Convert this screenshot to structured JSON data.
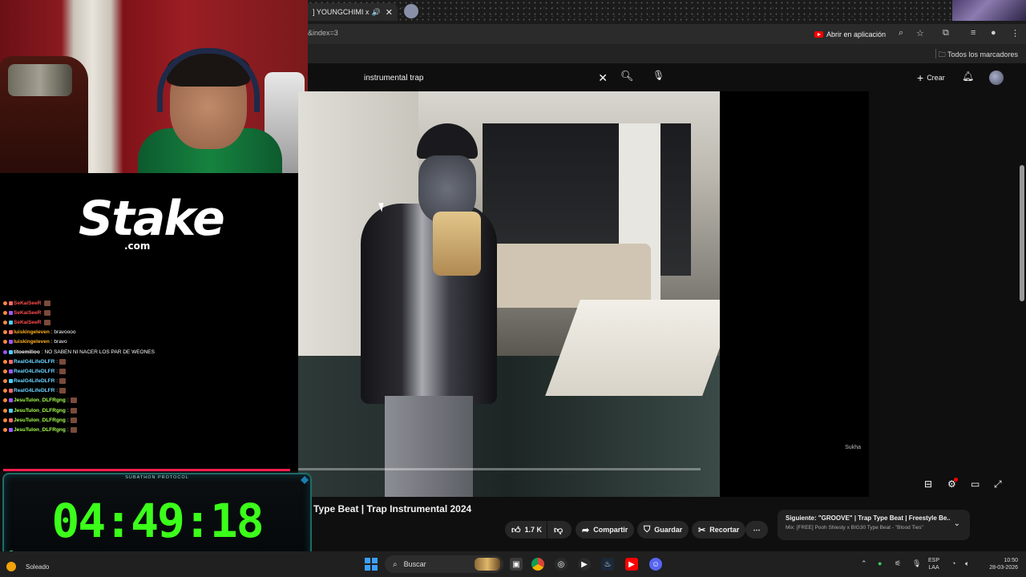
{
  "browser": {
    "tab_title": "] YOUNGCHIMI x CD",
    "url": "&index=3",
    "open_app_label": "Abrir en aplicación",
    "bookmarks_all": "Todos los marcadores"
  },
  "youtube": {
    "search_value": "instrumental trap",
    "create_label": "Crear",
    "video_title": "Type Beat | Trap Instrumental 2024",
    "likes": "1.7 K",
    "share_label": "Compartir",
    "save_label": "Guardar",
    "clip_label": "Recortar",
    "next_title": "Siguiente: \"GROOVE\" | Trap Type Beat | Freestyle Be...",
    "next_subtitle": "Mix: [FREE] Pooh Shiesty x BIG30 Type Beat - \"Blood Ties\"",
    "watermark": "Sukha",
    "progress": 1.0
  },
  "stream": {
    "sponsor": "Stake",
    "sponsor_sub": ".com",
    "timer_label": "SUBATHON PROTOCOL",
    "timer_value": "04:49:18",
    "chat": [
      {
        "user": "SeKaiSeeR",
        "text": "",
        "color": "#ff4d4d",
        "emote": true
      },
      {
        "user": "SeKaiSeeR",
        "text": "",
        "color": "#ff4d4d",
        "emote": true
      },
      {
        "user": "SeKaiSeeR",
        "text": "",
        "color": "#ff4d4d",
        "emote": true
      },
      {
        "user": "luiskingeleven",
        "text": ": bravoooo",
        "color": "#ffb020",
        "emote": false
      },
      {
        "user": "luiskingeleven",
        "text": ": bravo",
        "color": "#ffb020",
        "emote": false
      },
      {
        "user": "titoemilioo",
        "text": ": NO SABEN NI NACER LOS PAR DE WEONES",
        "color": "#ffffff",
        "emote": false
      },
      {
        "user": "RealG4LifeDLFR",
        "text": ":",
        "color": "#6ad4ff",
        "emote": true
      },
      {
        "user": "RealG4LifeDLFR",
        "text": ":",
        "color": "#6ad4ff",
        "emote": true
      },
      {
        "user": "RealG4LifeDLFR",
        "text": ":",
        "color": "#6ad4ff",
        "emote": true
      },
      {
        "user": "RealG4LifeDLFR",
        "text": ":",
        "color": "#6ad4ff",
        "emote": true
      },
      {
        "user": "JesuTulon_DLFRgng",
        "text": ":",
        "color": "#a6ff4d",
        "emote": true
      },
      {
        "user": "JesuTulon_DLFRgng",
        "text": ":",
        "color": "#a6ff4d",
        "emote": true
      },
      {
        "user": "JesuTulon_DLFRgng",
        "text": ":",
        "color": "#a6ff4d",
        "emote": true
      },
      {
        "user": "JesuTulon_DLFRgng",
        "text": ":",
        "color": "#a6ff4d",
        "emote": true
      }
    ]
  },
  "taskbar": {
    "weather": "Soleado",
    "search_label": "Buscar",
    "lang_top": "ESP",
    "lang_bottom": "LAA",
    "time": "10:50",
    "date": "28-03-2026"
  },
  "colors": {
    "timer_green": "#3bff1a",
    "youtube_red": "#ff0000",
    "timer_bar": "#ff1d4e"
  }
}
